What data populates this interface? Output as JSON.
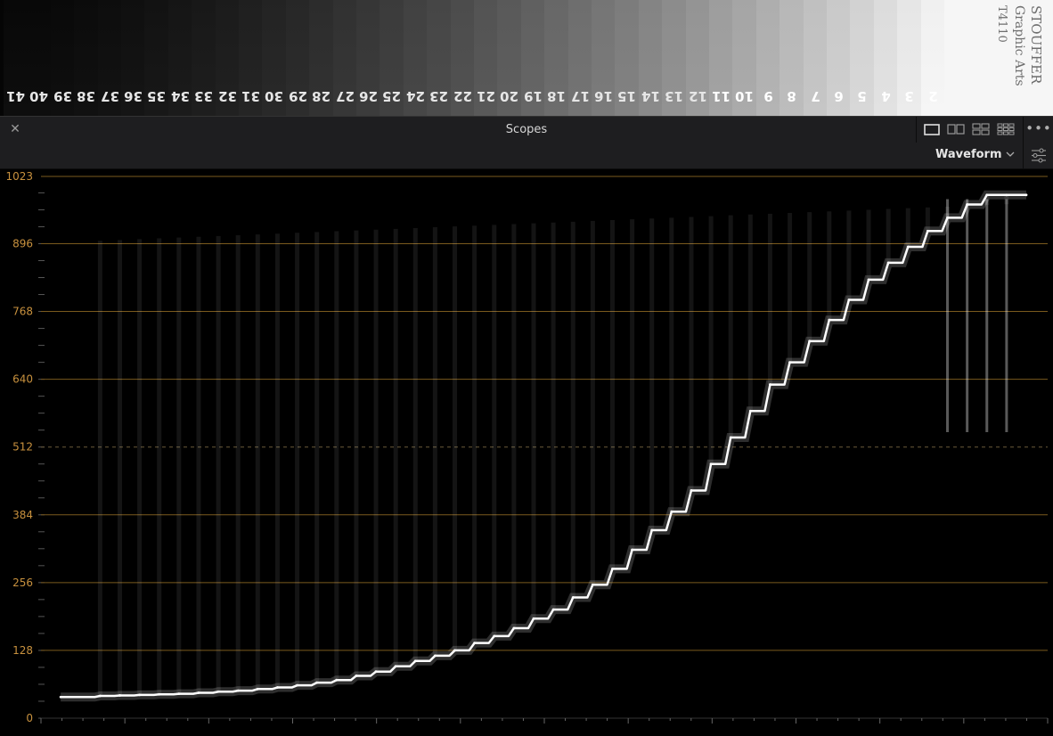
{
  "wedge": {
    "steps": [
      "41",
      "40",
      "39",
      "38",
      "37",
      "36",
      "35",
      "34",
      "33",
      "32",
      "31",
      "30",
      "29",
      "28",
      "27",
      "26",
      "25",
      "24",
      "23",
      "22",
      "21",
      "20",
      "19",
      "18",
      "17",
      "16",
      "15",
      "14",
      "13",
      "12",
      "11",
      "10",
      "9",
      "8",
      "7",
      "6",
      "5",
      "4",
      "3",
      "2"
    ],
    "brand_line1": "STOUFFER",
    "brand_line2": "Graphic Arts",
    "brand_line3": "T4110"
  },
  "header": {
    "close_icon": "close-icon",
    "title": "Scopes",
    "layout_icons": [
      "single-view-icon",
      "dual-view-icon",
      "quad-view-icon",
      "multi-view-icon"
    ],
    "more_icon": "more-options-icon"
  },
  "toolbar": {
    "scope_type": "Waveform",
    "settings_icon": "sliders-icon"
  },
  "colors": {
    "grid": "#7a5a1e",
    "axis_label": "#c8913e",
    "trace": "#ffffff"
  },
  "chart_data": {
    "type": "line",
    "title": "",
    "xlabel": "",
    "ylabel": "",
    "ylim": [
      0,
      1023
    ],
    "y_ticks": [
      0,
      128,
      256,
      384,
      512,
      640,
      768,
      896,
      1023
    ],
    "dashed_tick": 512,
    "grid": true,
    "x": [
      0.02,
      0.06,
      0.08,
      0.1,
      0.12,
      0.14,
      0.16,
      0.18,
      0.2,
      0.22,
      0.24,
      0.26,
      0.28,
      0.3,
      0.32,
      0.34,
      0.36,
      0.38,
      0.4,
      0.42,
      0.44,
      0.46,
      0.48,
      0.5,
      0.52,
      0.54,
      0.56,
      0.58,
      0.6,
      0.62,
      0.64,
      0.66,
      0.68,
      0.7,
      0.72,
      0.74,
      0.76,
      0.78,
      0.8,
      0.82,
      0.84,
      0.86,
      0.88,
      0.9,
      0.92,
      0.94,
      0.96,
      0.98,
      1.0
    ],
    "series": [
      {
        "name": "",
        "values": [
          40,
          42,
          43,
          44,
          45,
          46,
          48,
          50,
          52,
          55,
          58,
          62,
          67,
          72,
          80,
          88,
          98,
          108,
          118,
          128,
          142,
          155,
          170,
          188,
          205,
          228,
          252,
          282,
          318,
          355,
          390,
          430,
          480,
          530,
          580,
          630,
          672,
          712,
          752,
          790,
          828,
          860,
          890,
          920,
          945,
          970,
          988,
          988,
          988
        ]
      }
    ]
  }
}
